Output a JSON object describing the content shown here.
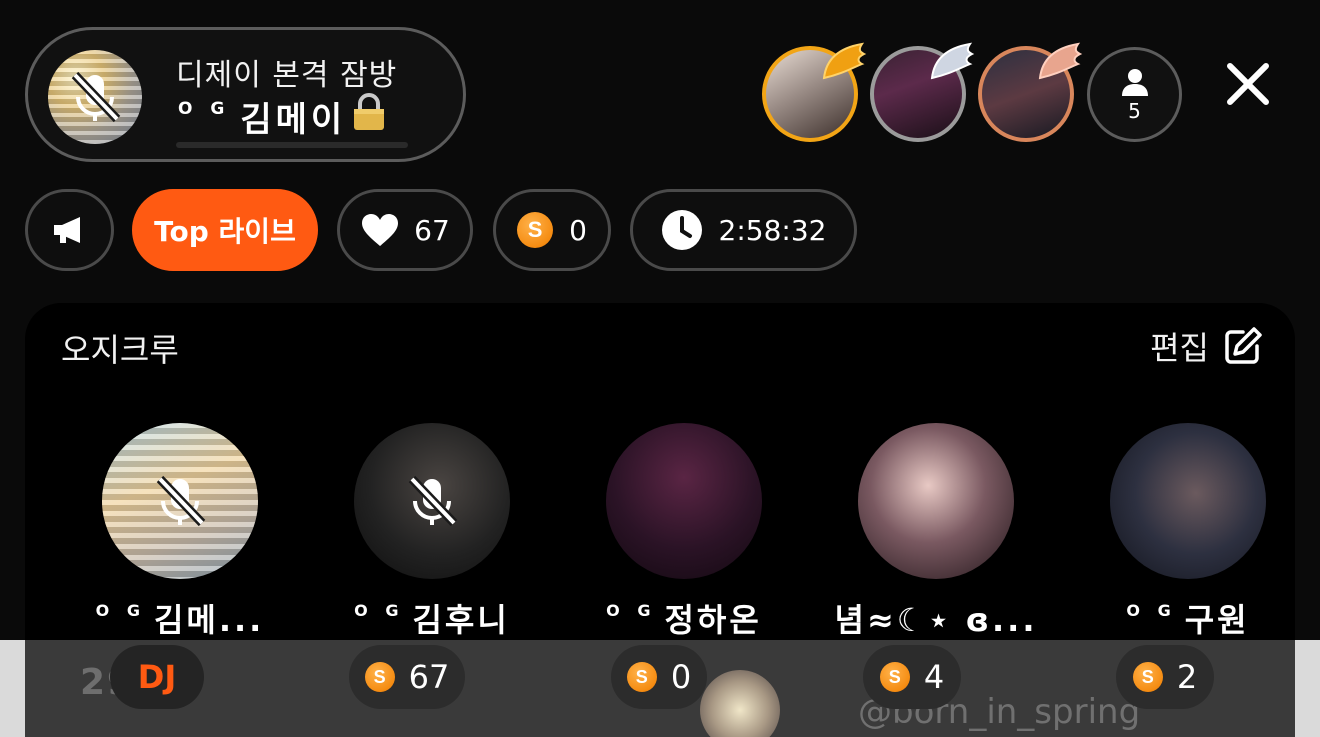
{
  "room": {
    "title": "디제이 본격 잠방",
    "host_prefix": "O G",
    "host_name": "김메이"
  },
  "header": {
    "viewer_count": "5"
  },
  "chips": {
    "top_live_label": "Top 라이브",
    "likes": "67",
    "coins": "0",
    "elapsed": "2:58:32"
  },
  "panel": {
    "title": "오지크루",
    "edit_label": "편집",
    "members": [
      {
        "prefix": "O G",
        "name": "김메...",
        "muted": true
      },
      {
        "prefix": "O G",
        "name": "김후니",
        "muted": true
      },
      {
        "prefix": "O G",
        "name": "정하온",
        "muted": false
      },
      {
        "prefix": "",
        "name": "념≈☾⋆ ɞ...",
        "muted": false
      },
      {
        "prefix": "O G",
        "name": "구원",
        "muted": false
      }
    ]
  },
  "badges": {
    "dj_label": "DJ",
    "values": [
      "67",
      "0",
      "4",
      "2"
    ]
  },
  "background": {
    "left_text": "29",
    "right_text": "@born_in_spring"
  },
  "colors": {
    "accent_orange": "#ff5a12",
    "coin": "#f58c12",
    "gold_ring": "#f2a516"
  },
  "icons": [
    "mic-off-icon",
    "lock-icon",
    "wing-icon",
    "person-icon",
    "close-icon",
    "megaphone-icon",
    "heart-icon",
    "coin-icon",
    "clock-icon",
    "edit-icon"
  ]
}
